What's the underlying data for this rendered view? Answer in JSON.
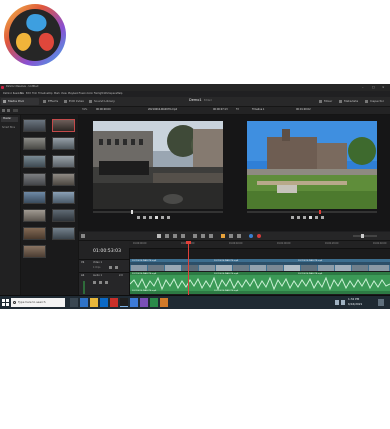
{
  "window": {
    "title": "DaVinci Resolve - Untitled",
    "controls": [
      "–",
      "□",
      "×"
    ]
  },
  "menu": [
    "DaVinci Resolve",
    "File",
    "Edit",
    "Trim",
    "Timeline",
    "Clip",
    "Mark",
    "View",
    "Playback",
    "Fusion",
    "Color",
    "Fairlight",
    "Workspace",
    "Help"
  ],
  "toolbar": {
    "left": [
      {
        "label": "Media Pool",
        "icon": "media-pool-icon"
      },
      {
        "label": "Effects",
        "icon": "effects-icon"
      },
      {
        "label": "Edit Index",
        "icon": "edit-index-icon"
      },
      {
        "label": "Sound Library",
        "icon": "sound-library-icon"
      }
    ],
    "project_title": "Demo1",
    "project_status": "Edited",
    "right": [
      {
        "label": "Mixer",
        "icon": "mixer-icon"
      },
      {
        "label": "Metadata",
        "icon": "metadata-icon"
      },
      {
        "label": "Inspector",
        "icon": "inspector-icon"
      }
    ]
  },
  "viewer_row": {
    "zoom": "31%",
    "source_timecode": "00:00:00:00",
    "source_clip": "20210616-WA0076.mp4",
    "source_duration": "00:00:07:13",
    "timeline_zoom": "Fit",
    "timeline_name": "Timeline 1",
    "record_timecode": "00:01:00:02"
  },
  "sidebar": {
    "header": "Master",
    "items": [
      "Smart Bins"
    ]
  },
  "timeline": {
    "timecode": "01:00:53:03",
    "ruler_ticks": [
      "01:00:00:00",
      "01:00:20:00",
      "01:00:40:00",
      "01:01:00:00",
      "01:01:20:00",
      "01:01:40:00"
    ],
    "video_track": {
      "name": "Video 1",
      "badge": "V1",
      "clip_count": "4 Clips"
    },
    "audio_track": {
      "name": "Audio 1",
      "badge": "A1",
      "level": "2.0"
    },
    "clips": [
      "20210616-WA0074.mp4",
      "20210616-WA0076.mp4",
      "20210616-WA0078.mp4"
    ]
  },
  "bottom_bar": {
    "app_name": "DaVinci Resolve 16",
    "pages": [
      {
        "label": "Media",
        "icon": "media-page-icon"
      },
      {
        "label": "Cut",
        "icon": "cut-page-icon"
      },
      {
        "label": "Edit",
        "icon": "edit-page-icon"
      },
      {
        "label": "Fusion",
        "icon": "fusion-page-icon"
      },
      {
        "label": "Color",
        "icon": "color-page-icon"
      },
      {
        "label": "Fairlight",
        "icon": "fairlight-page-icon"
      },
      {
        "label": "Deliver",
        "icon": "deliver-page-icon"
      }
    ],
    "active_page": "Edit"
  },
  "taskbar": {
    "search_placeholder": "Type here to search",
    "time": "1:32 PM",
    "date": "6/16/2021"
  },
  "colors": {
    "accent_red": "#d23c3c",
    "video_clip": "#3d6f90",
    "audio_clip": "#3b9a57",
    "playhead": "#e0403a"
  }
}
